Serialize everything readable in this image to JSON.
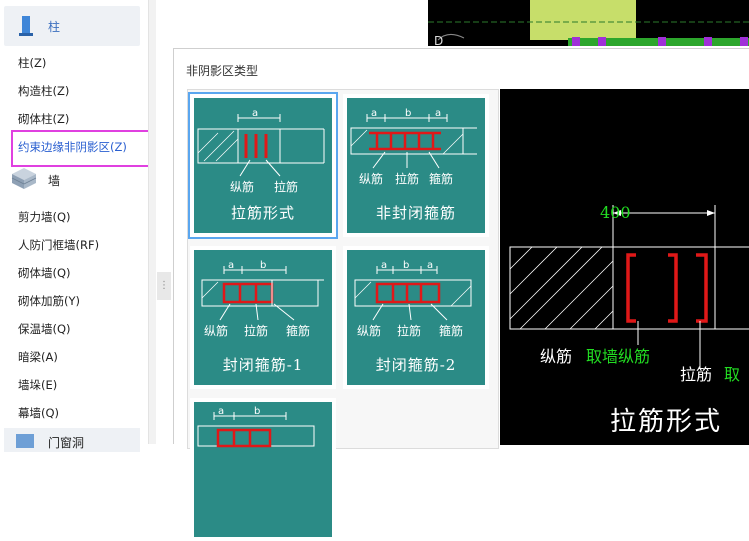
{
  "sidebar": {
    "groups": [
      {
        "label": "柱",
        "icon": "column-icon"
      },
      {
        "label": "墙",
        "icon": "wall-icon"
      },
      {
        "label": "门窗洞",
        "icon": "door-window-icon"
      }
    ],
    "column_items": [
      "柱(Z)",
      "构造柱(Z)",
      "砌体柱(Z)",
      "约束边缘非阴影区(Z)"
    ],
    "wall_items": [
      "剪力墙(Q)",
      "人防门框墙(RF)",
      "砌体墙(Q)",
      "砌体加筋(Y)",
      "保温墙(Q)",
      "暗梁(A)",
      "墙垛(E)",
      "幕墙(Q)"
    ]
  },
  "dialog": {
    "title": "非阴影区类型",
    "tiles": [
      {
        "caption": "拉筋形式",
        "top": [
          "a"
        ],
        "bottom": [
          "纵筋",
          "拉筋"
        ]
      },
      {
        "caption": "非封闭箍筋",
        "top": [
          "a",
          "b",
          "a"
        ],
        "bottom": [
          "纵筋",
          "拉筋",
          "箍筋"
        ]
      },
      {
        "caption": "封闭箍筋-1",
        "top": [
          "a",
          "b"
        ],
        "bottom": [
          "纵筋",
          "拉筋",
          "箍筋"
        ]
      },
      {
        "caption": "封闭箍筋-2",
        "top": [
          "a",
          "b",
          "a"
        ],
        "bottom": [
          "纵筋",
          "拉筋",
          "箍筋"
        ]
      },
      {
        "caption": "",
        "top": [
          "a",
          "b"
        ],
        "bottom": []
      }
    ],
    "preview": {
      "dimension": "400",
      "label_longbar": "纵筋",
      "label_longbar_value": "取墙纵筋",
      "label_tie": "拉筋",
      "label_tie_value": "取",
      "caption": "拉筋形式"
    }
  },
  "topcanvas": {
    "marker": "D"
  },
  "colors": {
    "teal": "#2b8b86",
    "red": "#e01818",
    "green": "#22dd22",
    "selection": "#e040e0"
  }
}
